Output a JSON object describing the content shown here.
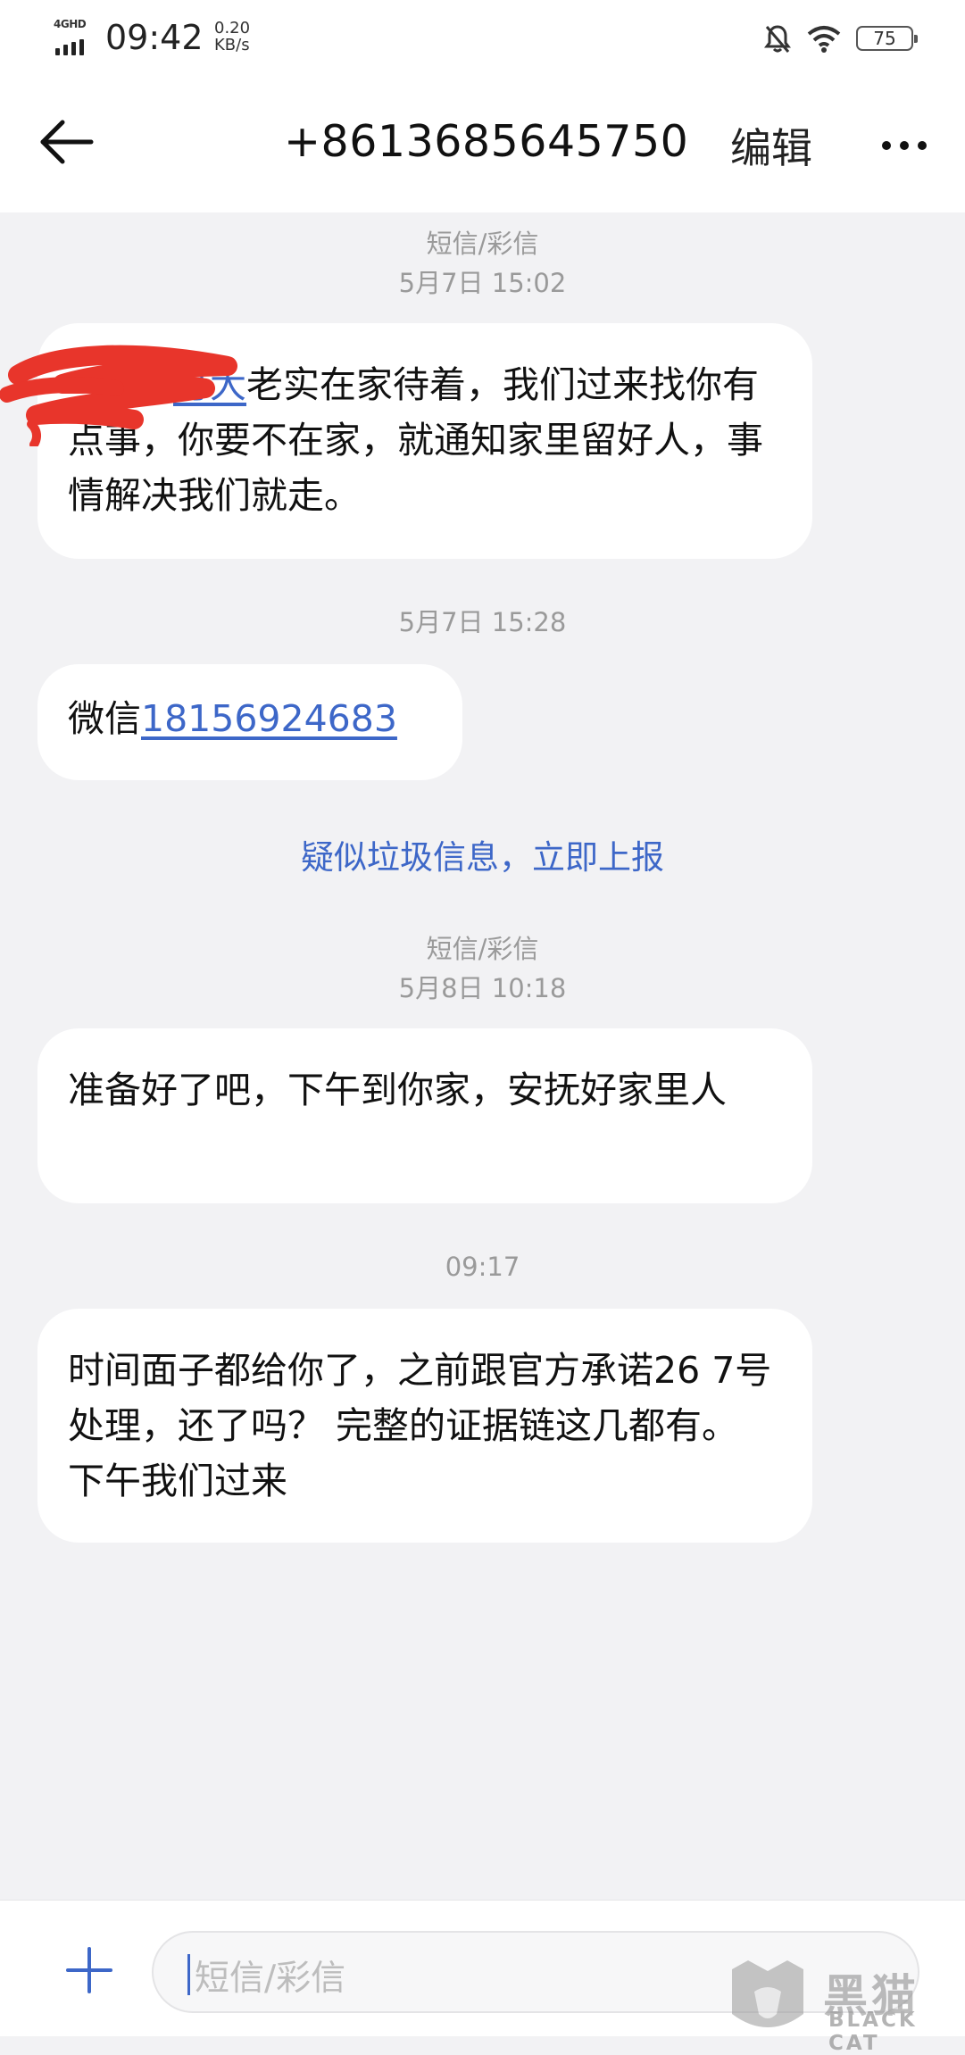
{
  "status_bar": {
    "network": "4GHD",
    "time": "09:42",
    "speed_value": "0.20",
    "speed_unit": "KB/s",
    "battery": "75",
    "icons": [
      "bell-muted-icon",
      "wifi-icon",
      "battery-icon"
    ]
  },
  "header": {
    "title": "+8613685645750",
    "edit_label": "编辑",
    "icons": [
      "back-arrow-icon",
      "more-icon"
    ]
  },
  "conversation": {
    "group1": {
      "type_label": "短信/彩信",
      "timestamp": "5月7日 15:02"
    },
    "msg1": {
      "redacted_link": "月大",
      "text": "老实在家待着，我们过来找你有点事，你要不在家，就通知家里留好人，事情解决我们就走。"
    },
    "group2": {
      "timestamp": "5月7日 15:28"
    },
    "msg2": {
      "prefix": "微信",
      "link": "18156924683"
    },
    "spam_report": "疑似垃圾信息，立即上报",
    "group3": {
      "type_label": "短信/彩信",
      "timestamp": "5月8日 10:18"
    },
    "msg3": {
      "text": "准备好了吧，下午到你家，安抚好家里人"
    },
    "group4": {
      "timestamp": "09:17"
    },
    "msg4": {
      "text": "时间面子都给你了，之前跟官方承诺26 7号处理，还了吗？ 完整的证据链这几都有。 下午我们过来"
    }
  },
  "composer": {
    "placeholder": "短信/彩信",
    "icons": [
      "plus-icon"
    ]
  },
  "watermark": {
    "text": "BLACK CAT",
    "chinese": "黑猫"
  },
  "colors": {
    "link": "#3d67c8",
    "background": "#f2f2f4",
    "bubble": "#ffffff"
  }
}
